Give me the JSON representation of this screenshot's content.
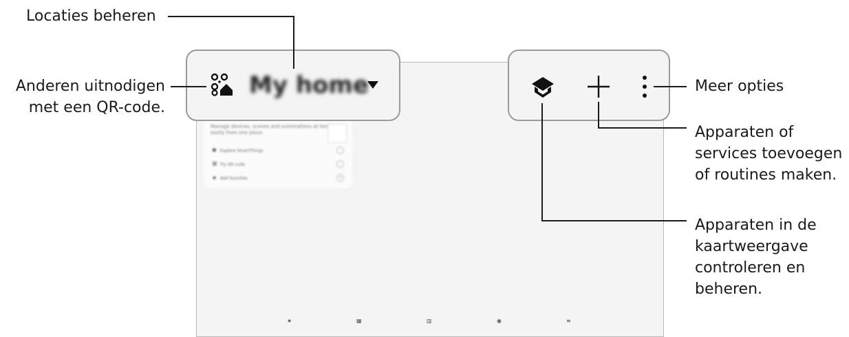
{
  "labels": {
    "manage_locations": "Locaties beheren",
    "invite_others": [
      "Anderen uitnodigen",
      "met een QR-code."
    ],
    "more_options": "Meer opties",
    "add_devices": [
      "Apparaten of",
      "services toevoegen",
      "of routines maken."
    ],
    "map_view": [
      "Apparaten in de",
      "kaartweergave",
      "controleren en",
      "beheren."
    ]
  },
  "header": {
    "location_title": "My home"
  },
  "icons": {
    "qr": "qr-code-home-icon",
    "location": "caret-down-icon",
    "map": "map-view-icon",
    "add": "plus-icon",
    "more": "more-options-icon"
  },
  "card": {
    "text_line1": "Manage devices, scenes and automations at home",
    "text_line2": "easily from one place.",
    "rows": [
      {
        "icon": "✱",
        "label": "Explore SmartThings"
      },
      {
        "icon": "⌘",
        "label": "Try QR code"
      },
      {
        "icon": "★",
        "label": "Add favorites"
      }
    ]
  },
  "bottom_nav": [
    "★",
    "▦",
    "▥",
    "◉",
    "≡"
  ]
}
